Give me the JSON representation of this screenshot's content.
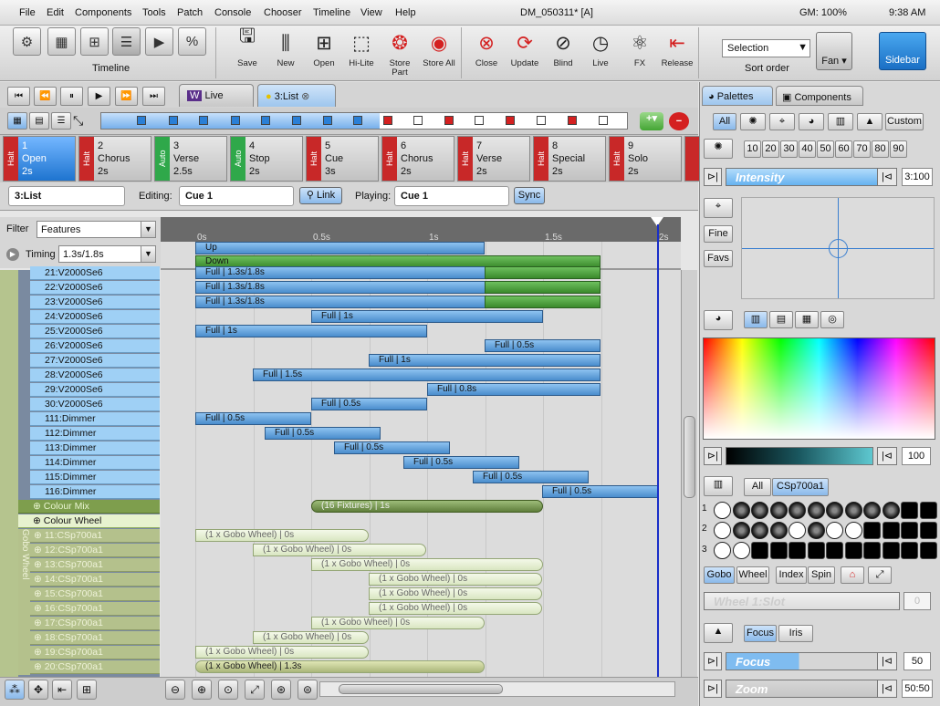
{
  "menu": [
    "File",
    "Edit",
    "Components",
    "Tools",
    "Patch",
    "Console",
    "Chooser",
    "Timeline",
    "View",
    "Help"
  ],
  "title": "DM_050311* [A]",
  "gm": "GM: 100%",
  "clock": "9:38 AM",
  "toolbar": {
    "timeline_label": "Timeline",
    "tools": [
      "Save",
      "New",
      "Open",
      "Hi-Lite",
      "Store Part",
      "Store All",
      "Close",
      "Update",
      "Blind",
      "Live",
      "FX",
      "Release"
    ],
    "selection": "Selection",
    "sort_order": "Sort order",
    "fan": "Fan",
    "sidebar": "Sidebar"
  },
  "tabs": {
    "live": "Live",
    "list": "3:List"
  },
  "cues": [
    {
      "num": "1",
      "name": "Open",
      "time": "2s",
      "side": "Halt"
    },
    {
      "num": "2",
      "name": "Chorus",
      "time": "2s",
      "side": "Halt"
    },
    {
      "num": "3",
      "name": "Verse",
      "time": "2.5s",
      "side": "Auto"
    },
    {
      "num": "4",
      "name": "Stop",
      "time": "2s",
      "side": "Auto"
    },
    {
      "num": "5",
      "name": "Cue",
      "time": "3s",
      "side": "Halt"
    },
    {
      "num": "6",
      "name": "Chorus",
      "time": "2s",
      "side": "Halt"
    },
    {
      "num": "7",
      "name": "Verse",
      "time": "2s",
      "side": "Halt"
    },
    {
      "num": "8",
      "name": "Special",
      "time": "2s",
      "side": "Halt"
    },
    {
      "num": "9",
      "name": "Solo",
      "time": "2s",
      "side": "Halt"
    }
  ],
  "edit": {
    "list": "3:List",
    "editing_label": "Editing:",
    "editing_value": "Cue 1",
    "link": "Link",
    "playing_label": "Playing:",
    "playing_value": "Cue 1",
    "sync": "Sync"
  },
  "filter": {
    "label": "Filter",
    "value": "Features",
    "timing_label": "Timing",
    "timing_value": "1.3s/1.8s"
  },
  "ruler": [
    "0s",
    "0.5s",
    "1s",
    "1.5s",
    "2s"
  ],
  "updown": {
    "up": "Up",
    "down": "Down"
  },
  "rows": [
    {
      "name": "21:V2000Se6",
      "bar": "Full | 1.3s/1.8s"
    },
    {
      "name": "22:V2000Se6",
      "bar": "Full | 1.3s/1.8s"
    },
    {
      "name": "23:V2000Se6",
      "bar": "Full | 1.3s/1.8s"
    },
    {
      "name": "24:V2000Se6",
      "bar": "Full | 1s"
    },
    {
      "name": "25:V2000Se6",
      "bar": "Full | 1s"
    },
    {
      "name": "26:V2000Se6",
      "bar": "Full | 0.5s"
    },
    {
      "name": "27:V2000Se6",
      "bar": "Full | 1s"
    },
    {
      "name": "28:V2000Se6",
      "bar": "Full | 1.5s"
    },
    {
      "name": "29:V2000Se6",
      "bar": "Full | 0.8s"
    },
    {
      "name": "30:V2000Se6",
      "bar": "Full | 0.5s"
    },
    {
      "name": "111:Dimmer",
      "bar": "Full | 0.5s"
    },
    {
      "name": "112:Dimmer",
      "bar": "Full | 0.5s"
    },
    {
      "name": "113:Dimmer",
      "bar": "Full | 0.5s"
    },
    {
      "name": "114:Dimmer",
      "bar": "Full | 0.5s"
    },
    {
      "name": "115:Dimmer",
      "bar": "Full | 0.5s"
    },
    {
      "name": "116:Dimmer",
      "bar": "Full | 0.5s"
    }
  ],
  "colour_mix": {
    "name": "Colour Mix",
    "bar": "(16 Fixtures) | 1s"
  },
  "colour_wheel": "Colour Wheel",
  "gobo_wheel_label": "Gobo Wheel",
  "gobo_rows": [
    {
      "name": "11:CSp700a1",
      "bar": "(1 x Gobo Wheel) | 0s"
    },
    {
      "name": "12:CSp700a1",
      "bar": "(1 x Gobo Wheel) | 0s"
    },
    {
      "name": "13:CSp700a1",
      "bar": "(1 x Gobo Wheel) | 0s"
    },
    {
      "name": "14:CSp700a1",
      "bar": "(1 x Gobo Wheel) | 0s"
    },
    {
      "name": "15:CSp700a1",
      "bar": "(1 x Gobo Wheel) | 0s"
    },
    {
      "name": "16:CSp700a1",
      "bar": "(1 x Gobo Wheel) | 0s"
    },
    {
      "name": "17:CSp700a1",
      "bar": "(1 x Gobo Wheel) | 0s"
    },
    {
      "name": "18:CSp700a1",
      "bar": "(1 x Gobo Wheel) | 0s"
    },
    {
      "name": "19:CSp700a1",
      "bar": "(1 x Gobo Wheel) | 0s"
    },
    {
      "name": "20:CSp700a1",
      "bar": "(1 x Gobo Wheel) | 1.3s"
    }
  ],
  "panel": {
    "tab_palettes": "Palettes",
    "tab_components": "Components",
    "all": "All",
    "custom": "Custom",
    "levels": [
      "10",
      "20",
      "30",
      "40",
      "50",
      "60",
      "70",
      "80",
      "90"
    ],
    "intensity": "Intensity",
    "intensity_value": "3:100",
    "fine": "Fine",
    "favs": "Favs",
    "color_value": "100",
    "gobo_all": "All",
    "gobo_fixture": "CSp700a1",
    "gobo_nums": [
      "1",
      "2",
      "3"
    ],
    "gobo_btns": [
      "Gobo",
      "Wheel",
      "Index",
      "Spin"
    ],
    "wheel_slot": "Wheel 1:Slot",
    "wheel_value": "0",
    "focus_btn": "Focus",
    "iris_btn": "Iris",
    "focus": "Focus",
    "focus_value": "50",
    "zoom": "Zoom",
    "zoom_value": "50:50"
  }
}
